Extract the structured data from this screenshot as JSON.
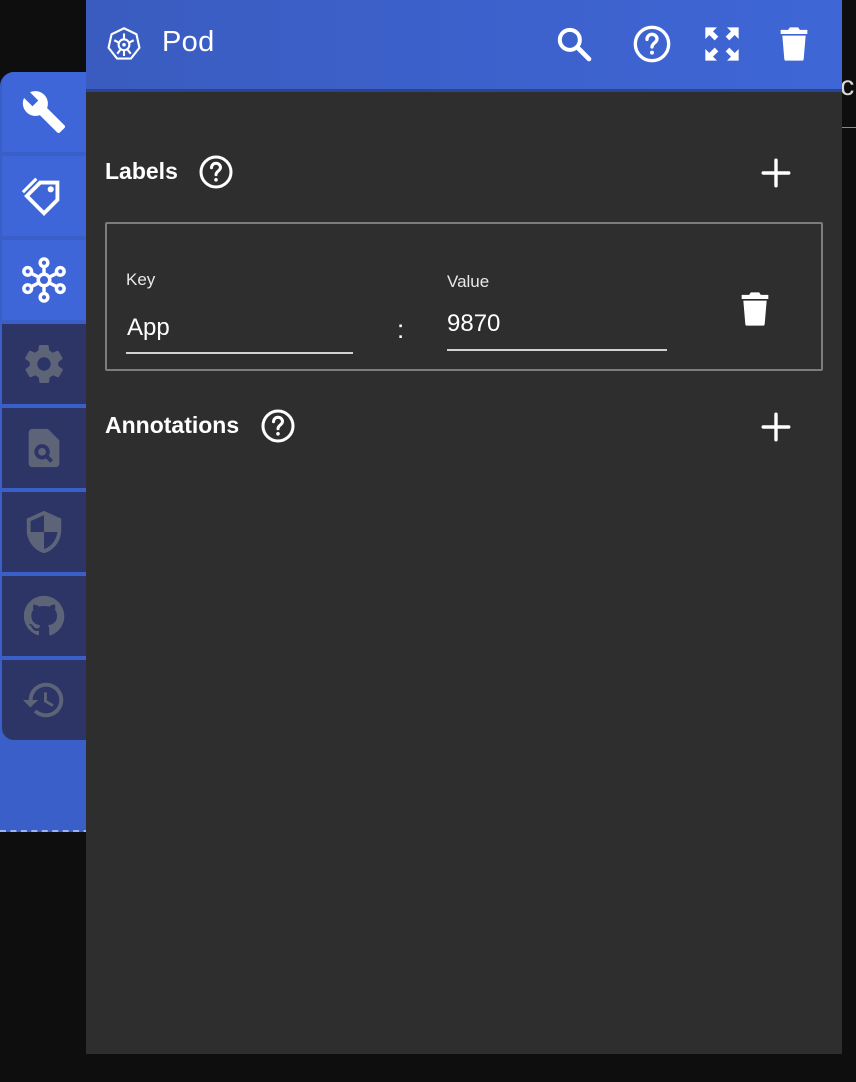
{
  "window": {
    "title": "Pod",
    "bg_partial_text": "ic"
  },
  "header_actions": [
    "search-icon",
    "help-icon",
    "fullscreen-icon",
    "trash-icon"
  ],
  "sidebar": {
    "items": [
      {
        "icon": "wrench-icon",
        "state": "active"
      },
      {
        "icon": "tag-icon",
        "state": "active"
      },
      {
        "icon": "network-icon",
        "state": "active"
      },
      {
        "icon": "gear-icon",
        "state": "inactive"
      },
      {
        "icon": "file-search-icon",
        "state": "inactive"
      },
      {
        "icon": "shield-icon",
        "state": "inactive"
      },
      {
        "icon": "github-icon",
        "state": "inactive"
      },
      {
        "icon": "history-icon",
        "state": "inactive"
      }
    ]
  },
  "labels": {
    "title": "Labels",
    "rows": [
      {
        "key_caption": "Key",
        "key": "App",
        "value_caption": "Value",
        "value": "9870",
        "separator": ":"
      }
    ]
  },
  "annotations": {
    "title": "Annotations"
  },
  "colors": {
    "header_blue": "#3f66d6",
    "panel_bg": "#2e2e2e",
    "sidebar_active": "#3e66d8",
    "sidebar_inactive": "#2c3566",
    "page_bg": "#0e0e0e"
  }
}
